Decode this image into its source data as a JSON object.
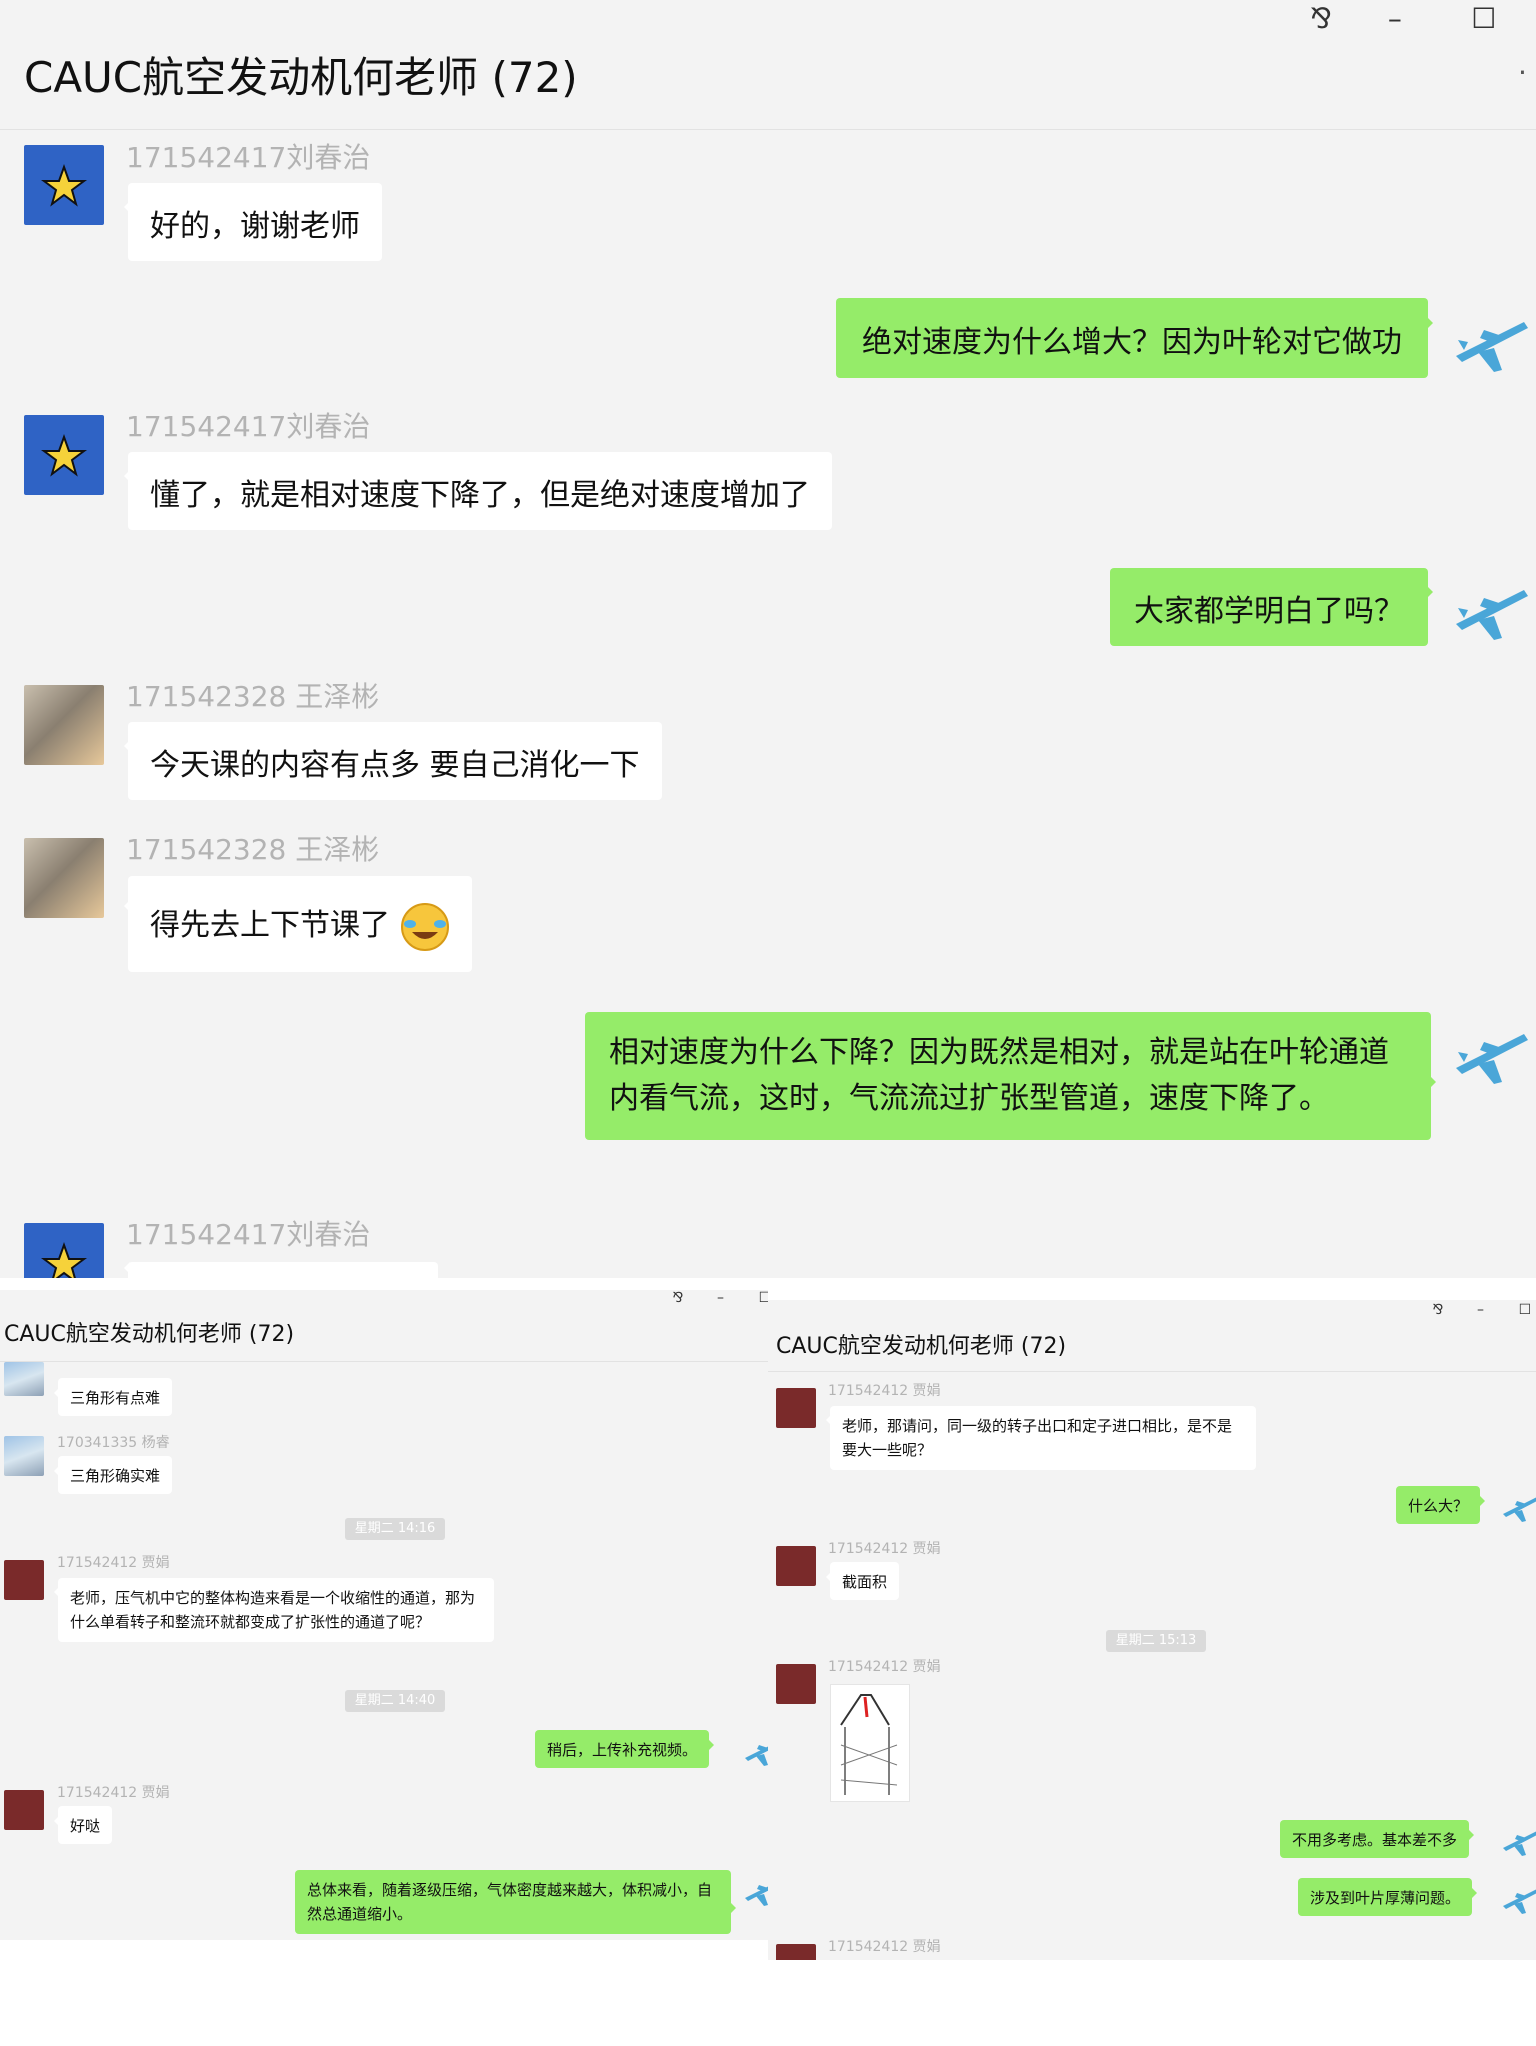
{
  "win1": {
    "title": "CAUC航空发动机何老师 (72)",
    "ctl_pin": "⅋",
    "ctl_min": "–",
    "ctl_max": "☐",
    "messages": [
      {
        "sender": "171542417刘春治",
        "text": "好的，谢谢老师"
      },
      {
        "text": "绝对速度为什么增大？因为叶轮对它做功"
      },
      {
        "sender": "171542417刘春治",
        "text": "懂了，就是相对速度下降了，但是绝对速度增加了"
      },
      {
        "text": "大家都学明白了吗？"
      },
      {
        "sender": "171542328 王泽彬",
        "text": "今天课的内容有点多 要自己消化一下"
      },
      {
        "sender": "171542328 王泽彬",
        "text": "得先去上下节课了"
      },
      {
        "text": "相对速度为什么下降？因为既然是相对，就是站在叶轮通道内看气流，这时，气流流过扩张型管道，速度下降了。"
      },
      {
        "sender": "171542417刘春治"
      }
    ]
  },
  "win2": {
    "title": "CAUC航空发动机何老师 (72)",
    "ctl_pin": "⅋",
    "ctl_min": "–",
    "ctl_max": "☐",
    "messages": [
      {
        "text": "三角形有点难"
      },
      {
        "sender": "170341335 杨睿",
        "text": "三角形确实难"
      },
      {
        "time": "星期二 14:16"
      },
      {
        "sender": "171542412  贾娟",
        "text": "老师，压气机中它的整体构造来看是一个收缩性的通道，那为什么单看转子和整流环就都变成了扩张性的通道了呢？"
      },
      {
        "time": "星期二 14:40"
      },
      {
        "text": "稍后，上传补充视频。"
      },
      {
        "sender": "171542412  贾娟",
        "text": "好哒"
      },
      {
        "text": "总体来看，随着逐级压缩，气体密度越来越大，体积减小，自然总通道缩小。"
      }
    ]
  },
  "win3": {
    "title": "CAUC航空发动机何老师 (72)",
    "ctl_pin": "⅋",
    "ctl_min": "–",
    "ctl_max": "☐",
    "messages": [
      {
        "sender": "171542412  贾娟",
        "text": "老师，那请问，同一级的转子出口和定子进口相比，是不是要大一些呢？"
      },
      {
        "text": "什么大？"
      },
      {
        "sender": "171542412  贾娟",
        "text": "截面积"
      },
      {
        "time": "星期二 15:13"
      },
      {
        "sender": "171542412  贾娟"
      },
      {
        "text": "不用多考虑。基本差不多"
      },
      {
        "text": "涉及到叶片厚薄问题。"
      },
      {
        "sender": "171542412  贾娟"
      }
    ]
  }
}
